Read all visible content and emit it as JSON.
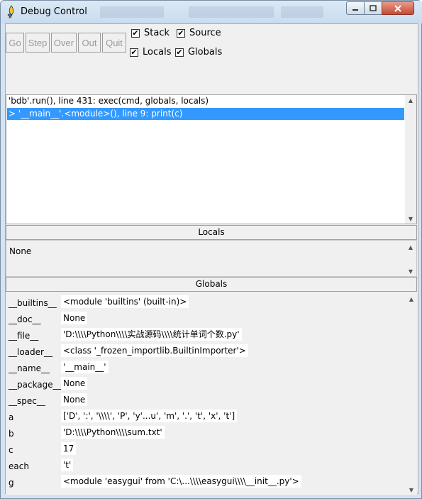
{
  "window": {
    "title": "Debug Control",
    "icons": {
      "app": "python-feather-icon",
      "minimize": "minimize-icon",
      "maximize": "maximize-icon",
      "close": "close-icon"
    }
  },
  "toolbar": {
    "buttons": [
      {
        "label": "Go"
      },
      {
        "label": "Step"
      },
      {
        "label": "Over"
      },
      {
        "label": "Out"
      },
      {
        "label": "Quit"
      }
    ],
    "checkboxes": {
      "stack": {
        "label": "Stack",
        "checked": true
      },
      "source": {
        "label": "Source",
        "checked": true
      },
      "locals": {
        "label": "Locals",
        "checked": true
      },
      "globals": {
        "label": "Globals",
        "checked": true
      }
    },
    "check_glyph": "✔"
  },
  "stack": {
    "rows": [
      {
        "text": "'bdb'.run(), line 431: exec(cmd, globals, locals)",
        "selected": false
      },
      {
        "text": "> '__main__'.<module>(), line 9: print(c)",
        "selected": true
      }
    ],
    "selection_color": "#3399ff"
  },
  "locals": {
    "header": "Locals",
    "value": "None"
  },
  "globals": {
    "header": "Globals",
    "rows": [
      {
        "name": "__builtins__",
        "value": "<module 'builtins' (built-in)>"
      },
      {
        "name": "__doc__",
        "value": "None"
      },
      {
        "name": "__file__",
        "value": "'D:\\\\\\\\Python\\\\\\\\实战源码\\\\\\\\统计单词个数.py'"
      },
      {
        "name": "__loader__",
        "value": "<class '_frozen_importlib.BuiltinImporter'>"
      },
      {
        "name": "__name__",
        "value": "'__main__'"
      },
      {
        "name": "__package__",
        "value": "None"
      },
      {
        "name": "__spec__",
        "value": "None"
      },
      {
        "name": "a",
        "value": "['D', ':', '\\\\\\\\', 'P', 'y'...u', 'm', '.', 't', 'x', 't']"
      },
      {
        "name": "b",
        "value": "'D:\\\\\\\\Python\\\\\\\\sum.txt'"
      },
      {
        "name": "c",
        "value": "17"
      },
      {
        "name": "each",
        "value": "'t'"
      },
      {
        "name": "g",
        "value": "<module 'easygui' from 'C:\\...\\\\\\\\easygui\\\\\\\\__init__.py'>"
      }
    ]
  },
  "scroll_arrows": {
    "up": "▲",
    "down": "▼"
  }
}
